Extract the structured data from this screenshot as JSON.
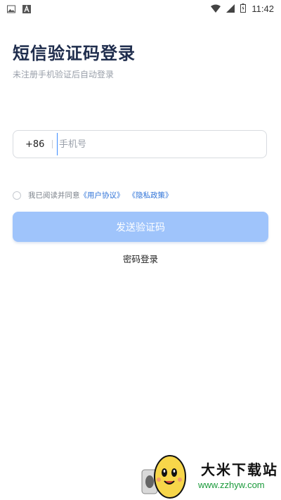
{
  "status_bar": {
    "time": "11:42",
    "icons_left": [
      "gallery-icon",
      "font-a-icon"
    ],
    "icons_right": [
      "wifi-icon",
      "signal-icon",
      "battery-icon"
    ]
  },
  "login": {
    "title": "短信验证码登录",
    "subtitle": "未注册手机验证后自动登录",
    "country_code": "+86",
    "phone_placeholder": "手机号",
    "phone_value": "",
    "agreement_prefix": "我已阅读并同意",
    "user_agreement_link": "《用户协议》",
    "privacy_policy_link": "《隐私政策》",
    "agree_checked": false,
    "send_code_button": "发送验证码",
    "password_login_link": "密码登录"
  },
  "watermark": {
    "site_name": "大米下载站",
    "site_url": "www.zzhyw.com"
  },
  "colors": {
    "title": "#1f2d4d",
    "button_disabled": "#9fc4fb",
    "link": "#2f73d8",
    "placeholder": "#9aa0aa"
  }
}
